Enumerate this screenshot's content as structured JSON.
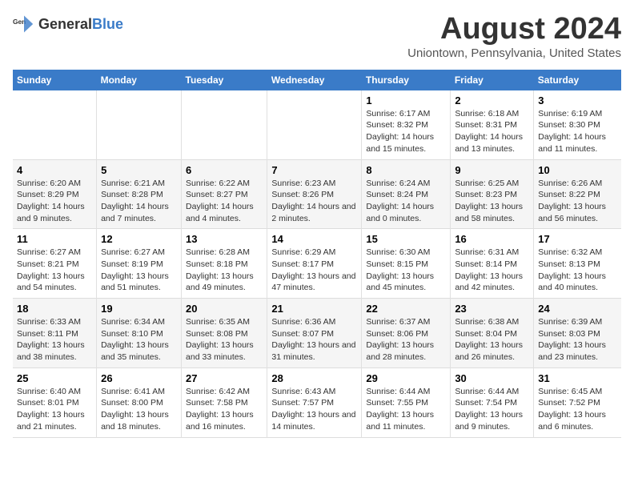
{
  "header": {
    "logo_general": "General",
    "logo_blue": "Blue",
    "title": "August 2024",
    "subtitle": "Uniontown, Pennsylvania, United States"
  },
  "columns": [
    "Sunday",
    "Monday",
    "Tuesday",
    "Wednesday",
    "Thursday",
    "Friday",
    "Saturday"
  ],
  "weeks": [
    [
      {
        "day": "",
        "text": ""
      },
      {
        "day": "",
        "text": ""
      },
      {
        "day": "",
        "text": ""
      },
      {
        "day": "",
        "text": ""
      },
      {
        "day": "1",
        "text": "Sunrise: 6:17 AM\nSunset: 8:32 PM\nDaylight: 14 hours and 15 minutes."
      },
      {
        "day": "2",
        "text": "Sunrise: 6:18 AM\nSunset: 8:31 PM\nDaylight: 14 hours and 13 minutes."
      },
      {
        "day": "3",
        "text": "Sunrise: 6:19 AM\nSunset: 8:30 PM\nDaylight: 14 hours and 11 minutes."
      }
    ],
    [
      {
        "day": "4",
        "text": "Sunrise: 6:20 AM\nSunset: 8:29 PM\nDaylight: 14 hours and 9 minutes."
      },
      {
        "day": "5",
        "text": "Sunrise: 6:21 AM\nSunset: 8:28 PM\nDaylight: 14 hours and 7 minutes."
      },
      {
        "day": "6",
        "text": "Sunrise: 6:22 AM\nSunset: 8:27 PM\nDaylight: 14 hours and 4 minutes."
      },
      {
        "day": "7",
        "text": "Sunrise: 6:23 AM\nSunset: 8:26 PM\nDaylight: 14 hours and 2 minutes."
      },
      {
        "day": "8",
        "text": "Sunrise: 6:24 AM\nSunset: 8:24 PM\nDaylight: 14 hours and 0 minutes."
      },
      {
        "day": "9",
        "text": "Sunrise: 6:25 AM\nSunset: 8:23 PM\nDaylight: 13 hours and 58 minutes."
      },
      {
        "day": "10",
        "text": "Sunrise: 6:26 AM\nSunset: 8:22 PM\nDaylight: 13 hours and 56 minutes."
      }
    ],
    [
      {
        "day": "11",
        "text": "Sunrise: 6:27 AM\nSunset: 8:21 PM\nDaylight: 13 hours and 54 minutes."
      },
      {
        "day": "12",
        "text": "Sunrise: 6:27 AM\nSunset: 8:19 PM\nDaylight: 13 hours and 51 minutes."
      },
      {
        "day": "13",
        "text": "Sunrise: 6:28 AM\nSunset: 8:18 PM\nDaylight: 13 hours and 49 minutes."
      },
      {
        "day": "14",
        "text": "Sunrise: 6:29 AM\nSunset: 8:17 PM\nDaylight: 13 hours and 47 minutes."
      },
      {
        "day": "15",
        "text": "Sunrise: 6:30 AM\nSunset: 8:15 PM\nDaylight: 13 hours and 45 minutes."
      },
      {
        "day": "16",
        "text": "Sunrise: 6:31 AM\nSunset: 8:14 PM\nDaylight: 13 hours and 42 minutes."
      },
      {
        "day": "17",
        "text": "Sunrise: 6:32 AM\nSunset: 8:13 PM\nDaylight: 13 hours and 40 minutes."
      }
    ],
    [
      {
        "day": "18",
        "text": "Sunrise: 6:33 AM\nSunset: 8:11 PM\nDaylight: 13 hours and 38 minutes."
      },
      {
        "day": "19",
        "text": "Sunrise: 6:34 AM\nSunset: 8:10 PM\nDaylight: 13 hours and 35 minutes."
      },
      {
        "day": "20",
        "text": "Sunrise: 6:35 AM\nSunset: 8:08 PM\nDaylight: 13 hours and 33 minutes."
      },
      {
        "day": "21",
        "text": "Sunrise: 6:36 AM\nSunset: 8:07 PM\nDaylight: 13 hours and 31 minutes."
      },
      {
        "day": "22",
        "text": "Sunrise: 6:37 AM\nSunset: 8:06 PM\nDaylight: 13 hours and 28 minutes."
      },
      {
        "day": "23",
        "text": "Sunrise: 6:38 AM\nSunset: 8:04 PM\nDaylight: 13 hours and 26 minutes."
      },
      {
        "day": "24",
        "text": "Sunrise: 6:39 AM\nSunset: 8:03 PM\nDaylight: 13 hours and 23 minutes."
      }
    ],
    [
      {
        "day": "25",
        "text": "Sunrise: 6:40 AM\nSunset: 8:01 PM\nDaylight: 13 hours and 21 minutes."
      },
      {
        "day": "26",
        "text": "Sunrise: 6:41 AM\nSunset: 8:00 PM\nDaylight: 13 hours and 18 minutes."
      },
      {
        "day": "27",
        "text": "Sunrise: 6:42 AM\nSunset: 7:58 PM\nDaylight: 13 hours and 16 minutes."
      },
      {
        "day": "28",
        "text": "Sunrise: 6:43 AM\nSunset: 7:57 PM\nDaylight: 13 hours and 14 minutes."
      },
      {
        "day": "29",
        "text": "Sunrise: 6:44 AM\nSunset: 7:55 PM\nDaylight: 13 hours and 11 minutes."
      },
      {
        "day": "30",
        "text": "Sunrise: 6:44 AM\nSunset: 7:54 PM\nDaylight: 13 hours and 9 minutes."
      },
      {
        "day": "31",
        "text": "Sunrise: 6:45 AM\nSunset: 7:52 PM\nDaylight: 13 hours and 6 minutes."
      }
    ]
  ]
}
